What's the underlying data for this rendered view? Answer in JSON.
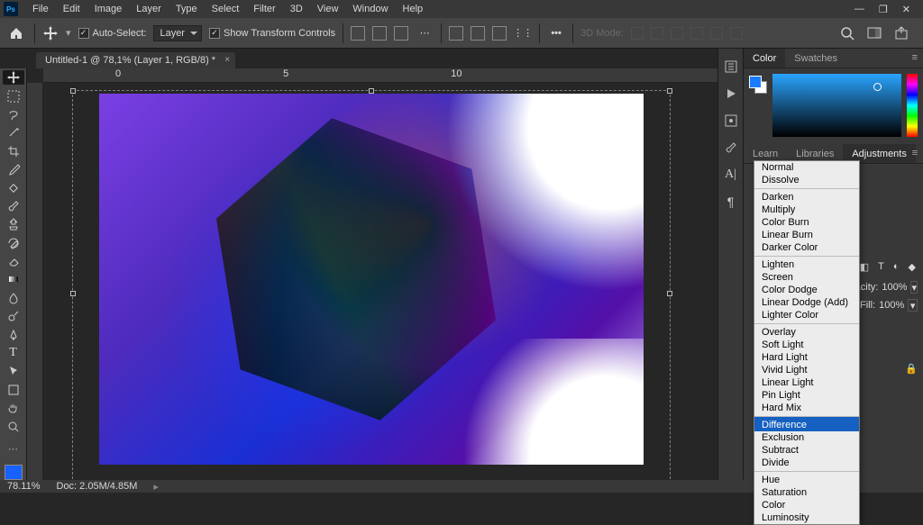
{
  "menu": {
    "items": [
      "File",
      "Edit",
      "Image",
      "Layer",
      "Type",
      "Select",
      "Filter",
      "3D",
      "View",
      "Window",
      "Help"
    ]
  },
  "options": {
    "auto_select": "Auto-Select:",
    "layer": "Layer",
    "show_transform": "Show Transform Controls",
    "mode3d": "3D Mode:"
  },
  "doc": {
    "title": "Untitled-1 @ 78,1% (Layer 1, RGB/8) *"
  },
  "ruler": {
    "m0": "0",
    "m1": "5",
    "m2": "10"
  },
  "panels": {
    "color": "Color",
    "swatches": "Swatches",
    "learn": "Learn",
    "libraries": "Libraries",
    "adjustments": "Adjustments"
  },
  "layerprops": {
    "opacity_label": "acity:",
    "opacity_val": "100%",
    "fill_label": "Fill:",
    "fill_val": "100%"
  },
  "blend_modes": {
    "g1": [
      "Normal",
      "Dissolve"
    ],
    "g2": [
      "Darken",
      "Multiply",
      "Color Burn",
      "Linear Burn",
      "Darker Color"
    ],
    "g3": [
      "Lighten",
      "Screen",
      "Color Dodge",
      "Linear Dodge (Add)",
      "Lighter Color"
    ],
    "g4": [
      "Overlay",
      "Soft Light",
      "Hard Light",
      "Vivid Light",
      "Linear Light",
      "Pin Light",
      "Hard Mix"
    ],
    "g5": [
      "Difference",
      "Exclusion",
      "Subtract",
      "Divide"
    ],
    "g6": [
      "Hue",
      "Saturation",
      "Color",
      "Luminosity"
    ],
    "selected": "Difference"
  },
  "status": {
    "zoom": "78.11%",
    "doc": "Doc: 2.05M/4.85M"
  }
}
